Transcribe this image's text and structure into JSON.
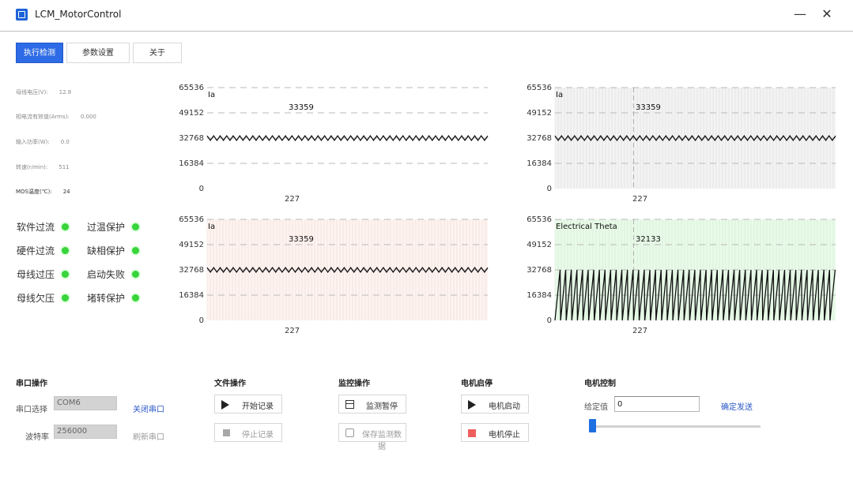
{
  "window": {
    "title": "LCM_MotorControl",
    "minimize": "—",
    "close": "✕"
  },
  "tabs": [
    {
      "label": "执行检测",
      "active": true
    },
    {
      "label": "参数设置",
      "active": false
    },
    {
      "label": "关于",
      "active": false
    }
  ],
  "readings": [
    {
      "label": "母线电压(V):",
      "value": "12.8"
    },
    {
      "label": "相电流有效值(Arms):",
      "value": "0.000"
    },
    {
      "label": "输入功率(W):",
      "value": "0.0"
    },
    {
      "label": "转速(r/min):",
      "value": "511"
    },
    {
      "label": "MOS温度(℃):",
      "value": "24"
    }
  ],
  "status": [
    {
      "label": "软件过流",
      "ok": true
    },
    {
      "label": "过温保护",
      "ok": true
    },
    {
      "label": "硬件过流",
      "ok": true
    },
    {
      "label": "缺相保护",
      "ok": true
    },
    {
      "label": "母线过压",
      "ok": true
    },
    {
      "label": "启动失败",
      "ok": true
    },
    {
      "label": "母线欠压",
      "ok": true
    },
    {
      "label": "堵转保护",
      "ok": true
    }
  ],
  "chart_data": [
    {
      "type": "line",
      "series": [
        {
          "name": "Ia",
          "kind": "ripple",
          "center": 32768,
          "amplitude": 1500,
          "cycles": 43
        }
      ],
      "readout": "33359",
      "x_tick": "227",
      "yticks": [
        "65536",
        "49152",
        "32768",
        "16384",
        "0"
      ],
      "ylim": [
        0,
        65536
      ],
      "background": "#ffffff",
      "grid": "dashed"
    },
    {
      "type": "line",
      "series": [
        {
          "name": "Ia",
          "kind": "ripple",
          "center": 32768,
          "amplitude": 1500,
          "cycles": 43
        }
      ],
      "readout": "33359",
      "x_tick": "227",
      "yticks": [
        "65536",
        "49152",
        "32768",
        "16384",
        "0"
      ],
      "ylim": [
        0,
        65536
      ],
      "background": "#f3f3f3",
      "grid": "dotted"
    },
    {
      "type": "line",
      "series": [
        {
          "name": "Ia",
          "kind": "ripple",
          "center": 32768,
          "amplitude": 1500,
          "cycles": 43
        }
      ],
      "readout": "33359",
      "x_tick": "227",
      "yticks": [
        "65536",
        "49152",
        "32768",
        "16384",
        "0"
      ],
      "ylim": [
        0,
        65536
      ],
      "background": "#fff3ef",
      "grid": "dotted"
    },
    {
      "type": "line",
      "series": [
        {
          "name": "Electrical Theta",
          "kind": "sawtooth",
          "min": 0,
          "max": 32768,
          "cycles": 50
        }
      ],
      "readout": "32133",
      "x_tick": "227",
      "yticks": [
        "65536",
        "49152",
        "32768",
        "16384",
        "0"
      ],
      "ylim": [
        0,
        65536
      ],
      "background": "#e8fbe8",
      "grid": "dotted"
    }
  ],
  "sections": {
    "serial": {
      "title": "串口操作",
      "port_label": "串口选择",
      "port_value": "COM6",
      "baud_label": "波特率",
      "baud_value": "256000",
      "close_link": "关闭串口",
      "refresh_link": "刷新串口"
    },
    "file": {
      "title": "文件操作",
      "start": "开始记录",
      "stop": "停止记录"
    },
    "monitor": {
      "title": "监控操作",
      "pause": "监测暂停",
      "save": "保存监测数据"
    },
    "motor": {
      "title": "电机启停",
      "start": "电机启动",
      "stop": "电机停止"
    },
    "control": {
      "title": "电机控制",
      "speed_label": "给定值",
      "speed_value": "0",
      "send_link": "确定发送",
      "slider": 0
    }
  },
  "colors": {
    "accent": "#2e6be6",
    "led": "#39d43c",
    "stop": "#f05d5d",
    "link": "#2a56c6"
  }
}
